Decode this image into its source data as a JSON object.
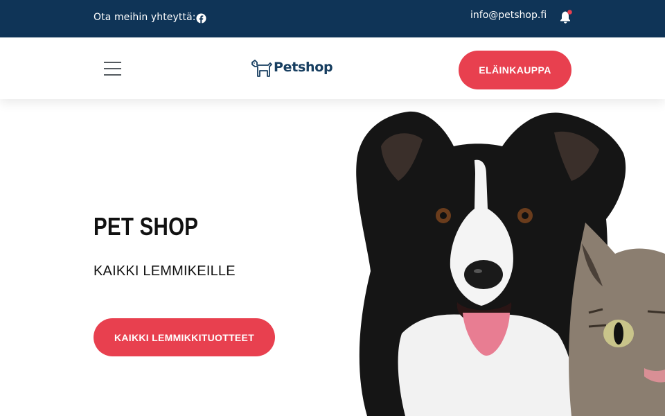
{
  "topbar": {
    "contact_label": "Ota meihin yhteyttä:",
    "email": "info@petshop.fi",
    "social_icon": "facebook-icon",
    "notification_icon": "bell-icon"
  },
  "header": {
    "menu_icon": "hamburger-menu-icon",
    "logo_text": "Petshop",
    "shop_button_label": "ELÄINKAUPPA"
  },
  "hero": {
    "title": "PET SHOP",
    "subtitle": "KAIKKI LEMMIKEILLE",
    "cta_label": "KAIKKI LEMMIKKITUOTTEET",
    "image": "dog-and-cat-photo"
  },
  "colors": {
    "topbar_bg": "#0f3457",
    "accent": "#e8404f",
    "logo": "#173e60",
    "text": "#111111"
  }
}
